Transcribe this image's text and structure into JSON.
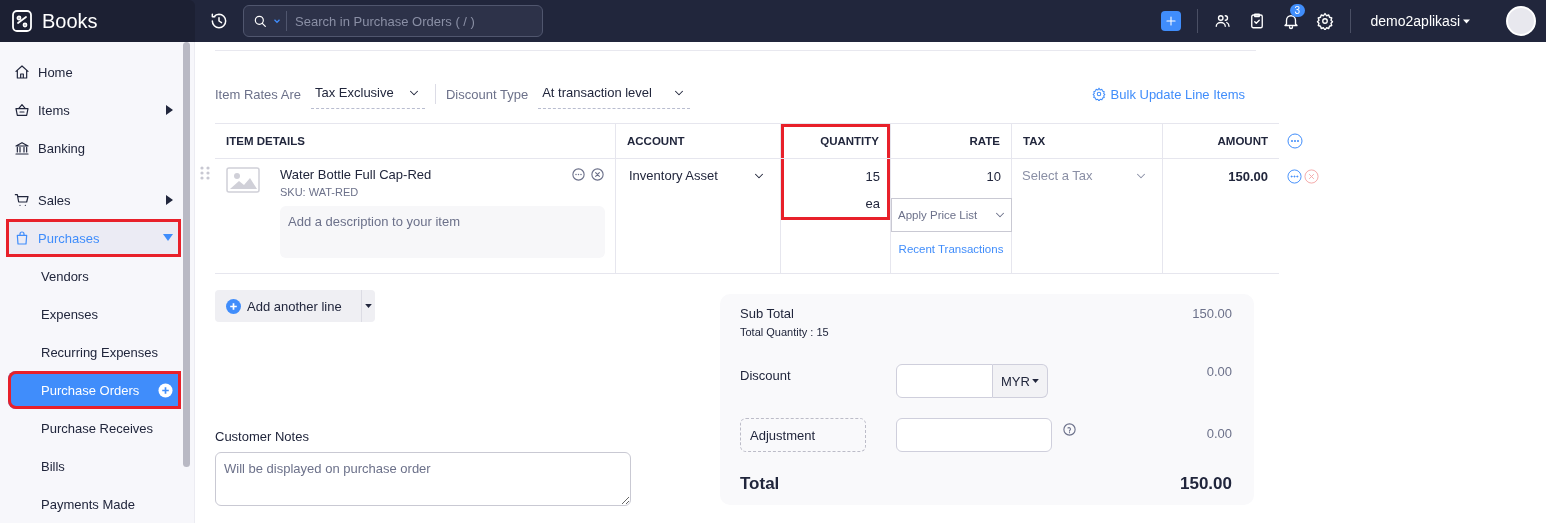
{
  "topbar": {
    "brand": "Books",
    "search_placeholder": "Search in Purchase Orders ( / )",
    "notification_count": "3",
    "user": "demo2aplikasi"
  },
  "sidebar": {
    "items": [
      {
        "label": "Home",
        "kind": "link",
        "selected": false,
        "highlighted": false
      },
      {
        "label": "Items",
        "kind": "group",
        "expanded": false,
        "selected": false,
        "highlighted": false
      },
      {
        "label": "Banking",
        "kind": "link",
        "selected": false,
        "highlighted": false
      },
      {
        "label": "Sales",
        "kind": "group",
        "expanded": false,
        "selected": false,
        "highlighted": false
      },
      {
        "label": "Purchases",
        "kind": "group",
        "expanded": true,
        "selected": true,
        "highlighted": true,
        "children": [
          {
            "label": "Vendors",
            "selected": false,
            "highlighted": false
          },
          {
            "label": "Expenses",
            "selected": false,
            "highlighted": false
          },
          {
            "label": "Recurring Expenses",
            "selected": false,
            "highlighted": false
          },
          {
            "label": "Purchase Orders",
            "selected": true,
            "highlighted": true
          },
          {
            "label": "Purchase Receives",
            "selected": false,
            "highlighted": false
          },
          {
            "label": "Bills",
            "selected": false,
            "highlighted": false
          },
          {
            "label": "Payments Made",
            "selected": false,
            "highlighted": false
          }
        ]
      }
    ]
  },
  "settings": {
    "item_rates": {
      "label": "Item Rates Are",
      "value": "Tax Exclusive"
    },
    "discount_type": {
      "label": "Discount Type",
      "value": "At transaction level"
    },
    "bulk_update": "Bulk Update Line Items"
  },
  "table": {
    "columns": [
      {
        "label": "ITEM DETAILS",
        "highlighted": false
      },
      {
        "label": "ACCOUNT",
        "highlighted": false
      },
      {
        "label": "QUANTITY",
        "highlighted": true
      },
      {
        "label": "RATE",
        "highlighted": false
      },
      {
        "label": "TAX",
        "highlighted": false
      },
      {
        "label": "AMOUNT",
        "highlighted": false
      }
    ],
    "rows": [
      {
        "name": "Water Bottle Full Cap-Red",
        "sku": "SKU: WAT-RED",
        "description_placeholder": "Add a description to your item",
        "account": "Inventory Asset",
        "quantity": "15",
        "unit": "ea",
        "rate": "10",
        "price_list_placeholder": "Apply Price List",
        "recent_transactions": "Recent Transactions",
        "tax_placeholder": "Select a Tax",
        "amount": "150.00"
      }
    ]
  },
  "add_line": "Add another line",
  "customer_notes": {
    "label": "Customer Notes",
    "placeholder": "Will be displayed on purchase order"
  },
  "totals": {
    "sub_total": {
      "label": "Sub Total",
      "value": "150.00"
    },
    "total_quantity": "Total Quantity : 15",
    "discount": {
      "label": "Discount",
      "currency": "MYR",
      "value": "0.00"
    },
    "adjustment": {
      "label": "Adjustment",
      "value": "0.00"
    },
    "total": {
      "label": "Total",
      "value": "150.00"
    }
  }
}
